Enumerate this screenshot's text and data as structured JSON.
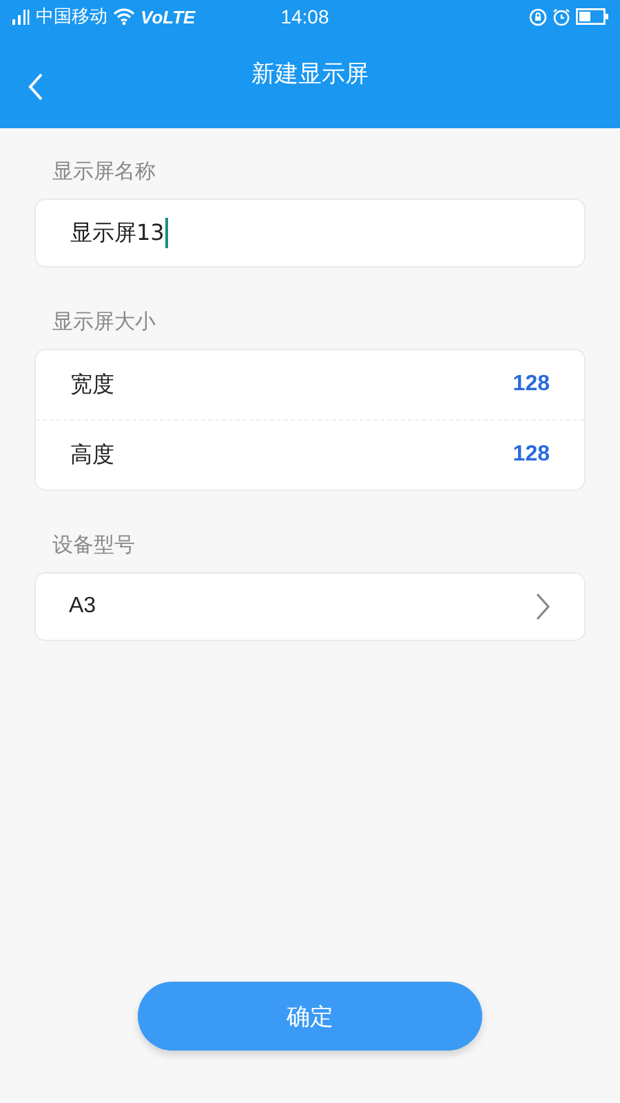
{
  "status_bar": {
    "carrier": "中国移动",
    "network": "VoLTE",
    "time": "14:08"
  },
  "header": {
    "title": "新建显示屏"
  },
  "sections": [
    {
      "kind": "text",
      "label": "显示屏名称",
      "value": "显示屏13"
    },
    {
      "kind": "pairs",
      "label": "显示屏大小",
      "rows": [
        {
          "name": "宽度",
          "value": "128"
        },
        {
          "name": "高度",
          "value": "128"
        }
      ]
    },
    {
      "kind": "select",
      "label": "设备型号",
      "value": "A3"
    }
  ],
  "confirm_button": "确定"
}
